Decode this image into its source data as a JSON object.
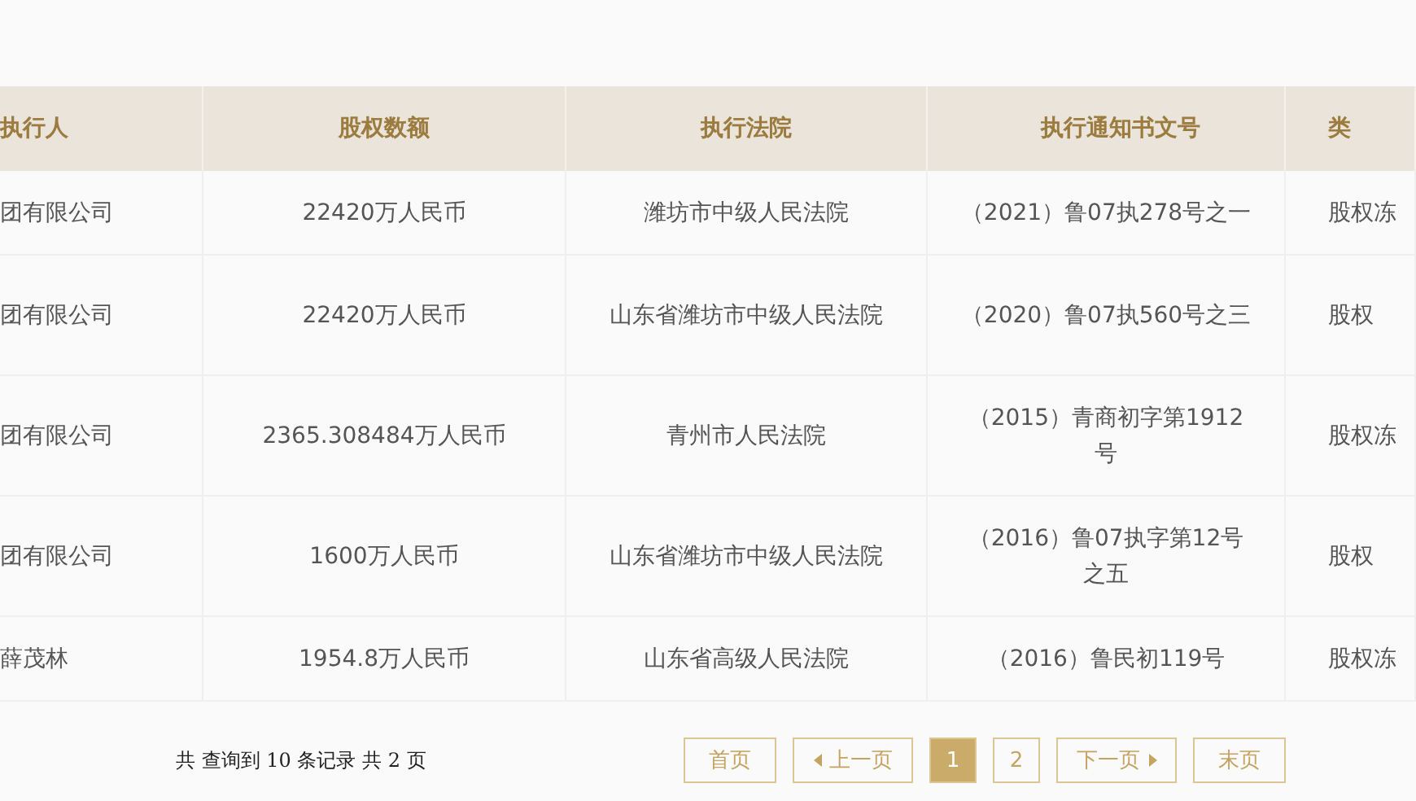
{
  "table": {
    "columns": [
      "执行人",
      "股权数额",
      "执行法院",
      "执行通知书文号",
      "类"
    ],
    "rows": [
      {
        "cells": [
          "团有限公司",
          "22420万人民币",
          "潍坊市中级人民法院",
          "（2021）鲁07执278号之一",
          "股权冻"
        ]
      },
      {
        "cells": [
          "团有限公司",
          "22420万人民币",
          "山东省潍坊市中级人民法院",
          "（2020）鲁07执560号之三",
          "股权"
        ]
      },
      {
        "cells": [
          "团有限公司",
          "2365.308484万人民币",
          "青州市人民法院",
          "（2015）青商初字第1912号",
          "股权冻"
        ]
      },
      {
        "cells": [
          "团有限公司",
          "1600万人民币",
          "山东省潍坊市中级人民法院",
          "（2016）鲁07执字第12号之五",
          "股权"
        ]
      },
      {
        "cells": [
          "薛茂林",
          "1954.8万人民币",
          "山东省高级人民法院",
          "（2016）鲁民初119号",
          "股权冻"
        ]
      }
    ]
  },
  "pagination": {
    "summary": "共 查询到 10 条记录 共 2 页",
    "buttons": [
      {
        "kind": "first",
        "label": "首页",
        "selected": false
      },
      {
        "kind": "prev",
        "label": "上一页",
        "selected": false
      },
      {
        "kind": "page",
        "label": "1",
        "selected": true
      },
      {
        "kind": "page",
        "label": "2",
        "selected": false
      },
      {
        "kind": "next",
        "label": "下一页",
        "selected": false
      },
      {
        "kind": "last",
        "label": "末页",
        "selected": false
      }
    ]
  }
}
